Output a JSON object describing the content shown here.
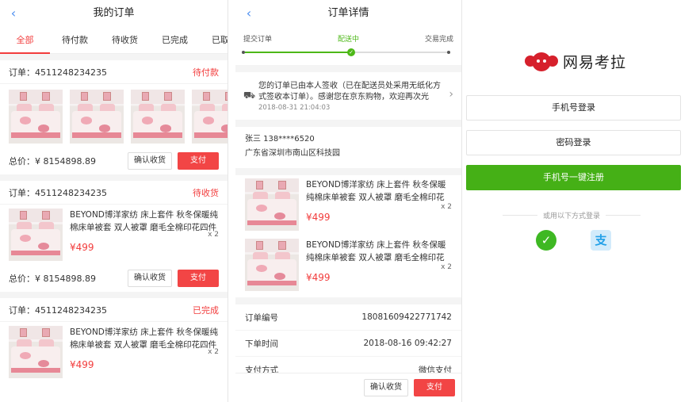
{
  "orders_page": {
    "title": "我的订单",
    "back_icon": "‹",
    "tabs": [
      "全部",
      "待付款",
      "待收货",
      "已完成",
      "已取消"
    ],
    "order_prefix": "订单：",
    "orders": [
      {
        "id": "4511248234235",
        "status": "待付款",
        "total_label": "总价：¥ 8154898.89",
        "confirm_label": "确认收货",
        "pay_label": "支付"
      },
      {
        "id": "4511248234235",
        "status": "待收货",
        "product_name": "BEYOND博洋家纺 床上套件 秋冬保暖纯棉床单被套 双人被罩 磨毛全棉印花四件套",
        "price": "¥499",
        "qty": "x 2",
        "total_label": "总价：¥ 8154898.89",
        "confirm_label": "确认收货",
        "pay_label": "支付"
      },
      {
        "id": "4511248234235",
        "status": "已完成",
        "product_name": "BEYOND博洋家纺 床上套件 秋冬保暖纯棉床单被套 双人被罩 磨毛全棉印花四件套",
        "price": "¥499",
        "qty": "x 2"
      }
    ]
  },
  "detail_page": {
    "title": "订单详情",
    "back_icon": "‹",
    "steps": [
      "提交订单",
      "配送中",
      "交易完成"
    ],
    "check_mark": "✓",
    "notice_message": "您的订单已由本人签收（已在配送员处采用无纸化方式签收本订单）。感谢您在京东购物，欢迎再次光临。",
    "notice_time": "2018-08-31 21:04:03",
    "truck_icon": "⛟",
    "chevron": "›",
    "receiver": "张三 138****6520",
    "address": "广东省深圳市南山区科技园",
    "items": [
      {
        "name": "BEYOND博洋家纺 床上套件 秋冬保暖纯棉床单被套 双人被罩 磨毛全棉印花四件套",
        "qty": "x 2",
        "price": "¥499"
      },
      {
        "name": "BEYOND博洋家纺 床上套件 秋冬保暖纯棉床单被套 双人被罩 磨毛全棉印花四件套",
        "qty": "x 2",
        "price": "¥499"
      }
    ],
    "meta": [
      {
        "label": "订单编号",
        "value": "18081609422771742"
      },
      {
        "label": "下单时间",
        "value": "2018-08-16 09:42:27"
      },
      {
        "label": "支付方式",
        "value": "微信支付"
      }
    ],
    "confirm_label": "确认收货",
    "pay_label": "支付"
  },
  "login_page": {
    "brand": "网易考拉",
    "phone_login": "手机号登录",
    "password_login": "密码登录",
    "quick_register": "手机号一键注册",
    "other_methods": "或用以下方式登录",
    "wechat_icon": "✓",
    "alipay_icon": "支"
  },
  "colors": {
    "accent_red": "#f24545",
    "green": "#45b016",
    "link_blue": "#4a8df0"
  }
}
